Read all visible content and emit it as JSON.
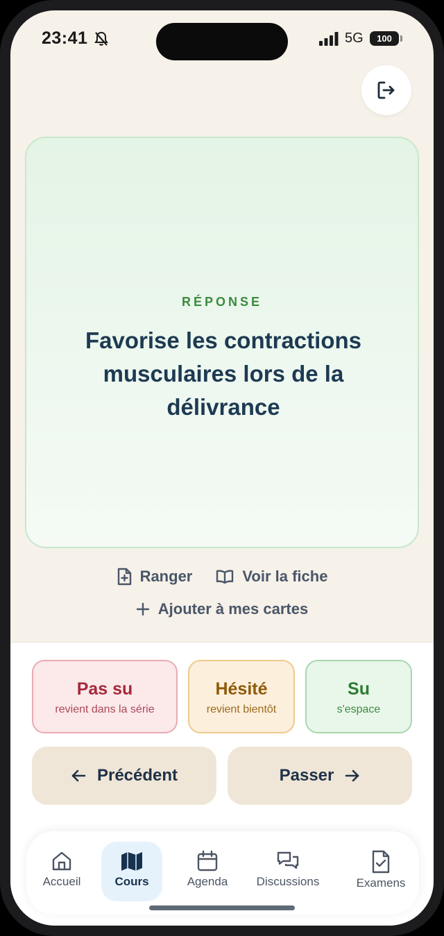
{
  "status_bar": {
    "time": "23:41",
    "network": "5G",
    "battery": "100",
    "icons": [
      "bell-slash-icon",
      "signal-icon"
    ]
  },
  "header": {
    "logout_icon": "logout-icon"
  },
  "card": {
    "label": "RÉPONSE",
    "text": "Favorise les contractions musculaires lors de la délivrance"
  },
  "actions": {
    "ranger": "Ranger",
    "voir_fiche": "Voir la fiche",
    "ajouter": "Ajouter à mes cartes"
  },
  "grades": [
    {
      "title": "Pas su",
      "subtitle": "revient dans la série"
    },
    {
      "title": "Hésité",
      "subtitle": "revient bientôt"
    },
    {
      "title": "Su",
      "subtitle": "s'espace"
    }
  ],
  "navigation": {
    "previous": "Précédent",
    "next": "Passer"
  },
  "tabs": [
    {
      "label": "Accueil",
      "icon": "home-icon",
      "active": false
    },
    {
      "label": "Cours",
      "icon": "map-icon",
      "active": true
    },
    {
      "label": "Agenda",
      "icon": "calendar-icon",
      "active": false
    },
    {
      "label": "Discussions",
      "icon": "chat-icon",
      "active": false
    },
    {
      "label": "Examens",
      "icon": "exam-file-icon",
      "active": false
    }
  ],
  "colors": {
    "background": "#f6f1e9",
    "card_green": "#e4f4e6",
    "label_green": "#3b8a3e",
    "text_navy": "#1d3a52",
    "bad": "#a3293a",
    "mid": "#8f5a08",
    "good": "#2e7d32",
    "nav_button": "#efe6d7",
    "tab_active": "#e6f2fb"
  }
}
